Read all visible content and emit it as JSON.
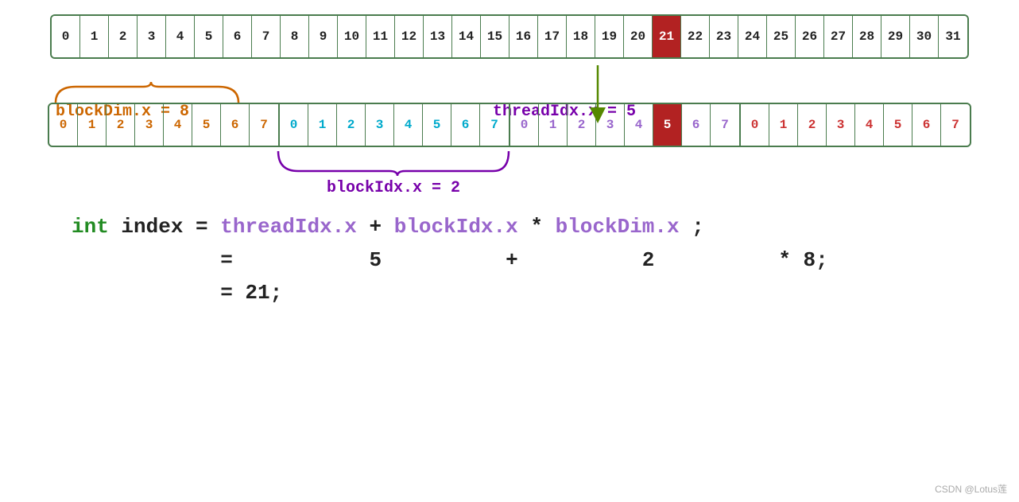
{
  "topArray": {
    "cells": [
      0,
      1,
      2,
      3,
      4,
      5,
      6,
      7,
      8,
      9,
      10,
      11,
      12,
      13,
      14,
      15,
      16,
      17,
      18,
      19,
      20,
      21,
      22,
      23,
      24,
      25,
      26,
      27,
      28,
      29,
      30,
      31
    ],
    "highlighted": 21
  },
  "middleArray": {
    "blocks": [
      {
        "id": 0,
        "cells": [
          0,
          1,
          2,
          3,
          4,
          5,
          6,
          7
        ]
      },
      {
        "id": 1,
        "cells": [
          0,
          1,
          2,
          3,
          4,
          5,
          6,
          7
        ]
      },
      {
        "id": 2,
        "cells": [
          0,
          1,
          2,
          3,
          4,
          5,
          6,
          7
        ]
      },
      {
        "id": 3,
        "cells": [
          0,
          1,
          2,
          3,
          4,
          5,
          6,
          7
        ]
      }
    ],
    "highlightedBlock": 2,
    "highlightedCell": 5
  },
  "labels": {
    "blockDim": "blockDim.x = 8",
    "threadIdx": "threadIdx.x = 5",
    "blockIdx": "blockIdx.x = 2"
  },
  "formula": {
    "line1": "int  index = threadIdx.x + blockIdx.x * blockDim.x;",
    "line2": "            =          5        +       2        * 8;",
    "line3": "            = 21;"
  },
  "watermark": "CSDN @Lotus莲"
}
